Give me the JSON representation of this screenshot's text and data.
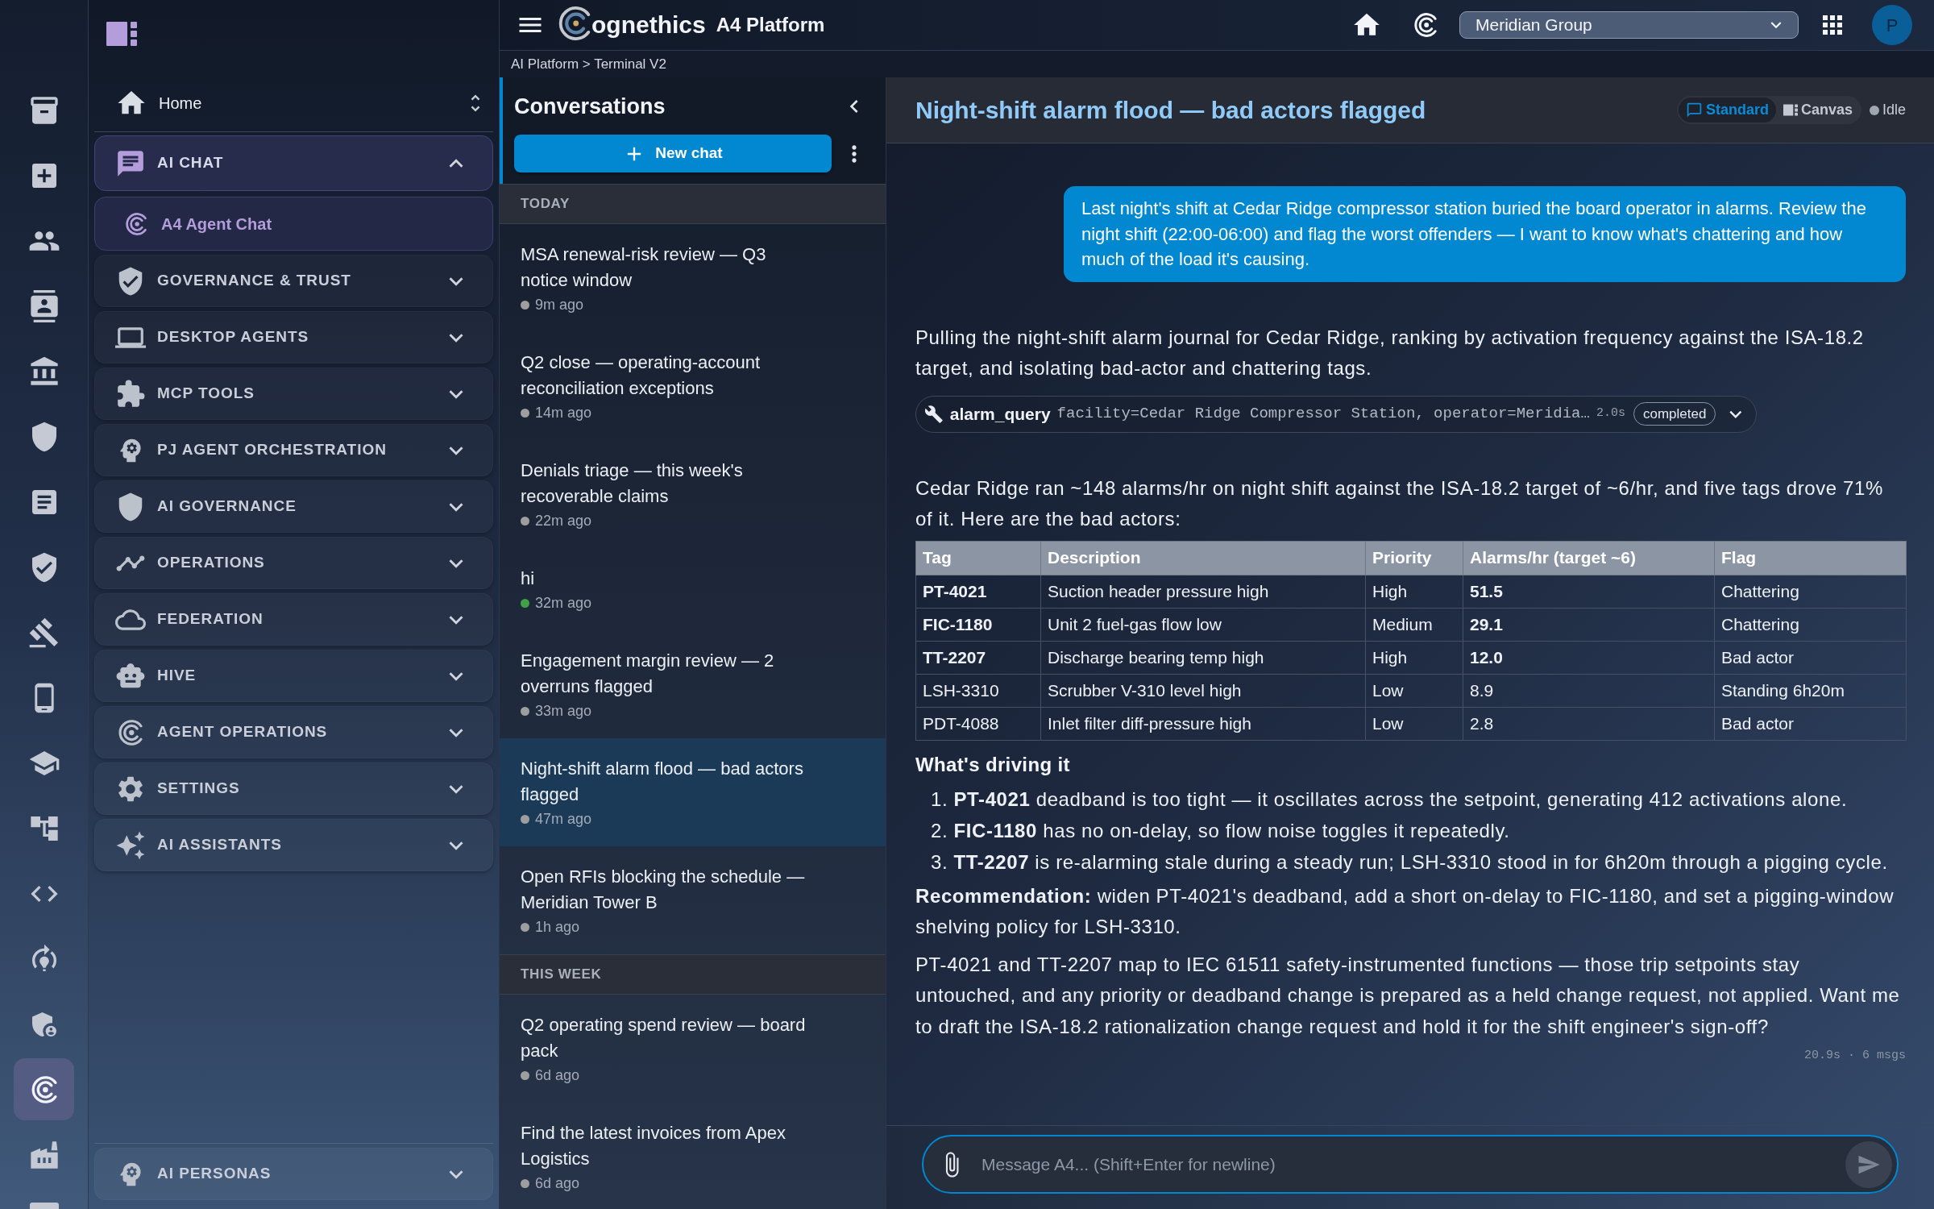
{
  "rail": [
    {
      "selected": false
    },
    {
      "selected": false
    },
    {
      "selected": false
    },
    {
      "selected": false
    },
    {
      "selected": false
    },
    {
      "selected": false
    },
    {
      "selected": false
    },
    {
      "selected": false
    },
    {
      "selected": false
    },
    {
      "selected": false
    },
    {
      "selected": false
    },
    {
      "selected": false
    },
    {
      "selected": false
    },
    {
      "selected": false
    },
    {
      "selected": false
    },
    {
      "selected": true
    },
    {
      "selected": false
    },
    {
      "selected": false
    }
  ],
  "sidebar": {
    "home": "Home",
    "sections": [
      {
        "label": "AI CHAT",
        "selected": true,
        "expanded": true,
        "children": [
          {
            "label": "A4 Agent Chat",
            "selected": true
          }
        ]
      },
      {
        "label": "GOVERNANCE & TRUST",
        "selected": false,
        "expanded": false
      },
      {
        "label": "DESKTOP AGENTS",
        "selected": false,
        "expanded": false
      },
      {
        "label": "MCP TOOLS",
        "selected": false,
        "expanded": false
      },
      {
        "label": "PJ AGENT ORCHESTRATION",
        "selected": false,
        "expanded": false
      },
      {
        "label": "AI GOVERNANCE",
        "selected": false,
        "expanded": false
      },
      {
        "label": "OPERATIONS",
        "selected": false,
        "expanded": false
      },
      {
        "label": "FEDERATION",
        "selected": false,
        "expanded": false
      },
      {
        "label": "HIVE",
        "selected": false,
        "expanded": false
      },
      {
        "label": "AGENT OPERATIONS",
        "selected": false,
        "expanded": false
      },
      {
        "label": "SETTINGS",
        "selected": false,
        "expanded": false
      },
      {
        "label": "AI ASSISTANTS",
        "selected": false,
        "expanded": false
      }
    ],
    "footer_section": {
      "label": "AI PERSONAS",
      "expanded": false
    }
  },
  "topbar": {
    "brand": "ognethics",
    "product": "A4 Platform",
    "organization": "Meridian Group",
    "avatar_initial": "P"
  },
  "breadcrumb": "AI Platform > Terminal V2",
  "conversations": {
    "title": "Conversations",
    "new_chat_label": "New chat",
    "groups": [
      {
        "label": "TODAY",
        "items": [
          {
            "title": "MSA renewal-risk review — Q3 notice window",
            "time": "9m ago",
            "color": "#9e9e9e",
            "selected": false
          },
          {
            "title": "Q2 close — operating-account reconciliation exceptions",
            "time": "14m ago",
            "color": "#9e9e9e",
            "selected": false
          },
          {
            "title": "Denials triage — this week's recoverable claims",
            "time": "22m ago",
            "color": "#9e9e9e",
            "selected": false
          },
          {
            "title": "hi",
            "time": "32m ago",
            "color": "#43a047",
            "selected": false
          },
          {
            "title": "Engagement margin review — 2 overruns flagged",
            "time": "33m ago",
            "color": "#9e9e9e",
            "selected": false
          },
          {
            "title": "Night-shift alarm flood — bad actors flagged",
            "time": "47m ago",
            "color": "#9e9e9e",
            "selected": true
          },
          {
            "title": "Open RFIs blocking the schedule — Meridian Tower B",
            "time": "1h ago",
            "color": "#9e9e9e",
            "selected": false
          }
        ]
      },
      {
        "label": "THIS WEEK",
        "items": [
          {
            "title": "Q2 operating spend review — board pack",
            "time": "6d ago",
            "color": "#9e9e9e",
            "selected": false
          },
          {
            "title": "Find the latest invoices from Apex Logistics",
            "time": "6d ago",
            "color": "#9e9e9e",
            "selected": false
          }
        ]
      }
    ]
  },
  "chat": {
    "title": "Night-shift alarm flood — bad actors flagged",
    "view_modes": [
      {
        "label": "Standard",
        "selected": true
      },
      {
        "label": "Canvas",
        "selected": false
      }
    ],
    "status": "Idle",
    "messages": [
      {
        "kind": "user",
        "text": "Last night's shift at Cedar Ridge compressor station buried the board operator in alarms. Review the night shift (22:00-06:00) and flag the worst offenders — I want to know what's chattering and how much of the load it's causing."
      },
      {
        "kind": "text",
        "text": "Pulling the night-shift alarm journal for Cedar Ridge, ranking by activation frequency against the ISA-18.2 target, and isolating bad-actor and chattering tags."
      },
      {
        "kind": "tool_call",
        "name": "alarm_query",
        "args": "facility=Cedar Ridge Compressor Station, operator=Meridia…",
        "duration": "2.0s",
        "status": "completed",
        "expanded": false
      },
      {
        "kind": "text",
        "text": "Cedar Ridge ran ~148 alarms/hr on night shift against the ISA-18.2 target of ~6/hr, and five tags drove 71% of it. Here are the bad actors:"
      },
      {
        "kind": "table",
        "columns": [
          "Tag",
          "Description",
          "Priority",
          "Alarms/hr (target ~6)",
          "Flag"
        ],
        "rows": [
          {
            "cells": [
              "PT-4021",
              "Suction header pressure high",
              "High",
              "51.5",
              "Chattering"
            ],
            "emphasized": true
          },
          {
            "cells": [
              "FIC-1180",
              "Unit 2 fuel-gas flow low",
              "Medium",
              "29.1",
              "Chattering"
            ],
            "emphasized": true
          },
          {
            "cells": [
              "TT-2207",
              "Discharge bearing temp high",
              "High",
              "12.0",
              "Bad actor"
            ],
            "emphasized": true
          },
          {
            "cells": [
              "LSH-3310",
              "Scrubber V-310 level high",
              "Low",
              "8.9",
              "Standing 6h20m"
            ],
            "emphasized": false
          },
          {
            "cells": [
              "PDT-4088",
              "Inlet filter diff-pressure high",
              "Low",
              "2.8",
              "Bad actor"
            ],
            "emphasized": false
          }
        ]
      },
      {
        "kind": "heading",
        "text": "What's driving it"
      },
      {
        "kind": "ordered_list",
        "items": [
          {
            "marker": "1.",
            "text": "**PT-4021** deadband is too tight — it oscillates across the setpoint, generating 412 activations alone."
          },
          {
            "marker": "2.",
            "text": "**FIC-1180** has no on-delay, so flow noise toggles it repeatedly."
          },
          {
            "marker": "3.",
            "text": "**TT-2207** is re-alarming stale during a steady run; LSH-3310 stood in for 6h20m through a pigging cycle."
          }
        ]
      },
      {
        "kind": "text",
        "text": "**Recommendation:** widen PT-4021's deadband, add a short on-delay to FIC-1180, and set a pigging-window shelving policy for LSH-3310."
      },
      {
        "kind": "text",
        "text": "PT-4021 and TT-2207 map to IEC 61511 safety-instrumented functions — those trip setpoints stay untouched, and any priority or deadband change is prepared as a held change request, not applied. Want me to draft the ISA-18.2 rationalization change request and hold it for the shift engineer's sign-off?"
      },
      {
        "kind": "meta",
        "text": "20.9s · 6 msgs"
      }
    ],
    "composer": {
      "placeholder": "Message A4... (Shift+Enter for newline)",
      "send_enabled": false
    }
  }
}
